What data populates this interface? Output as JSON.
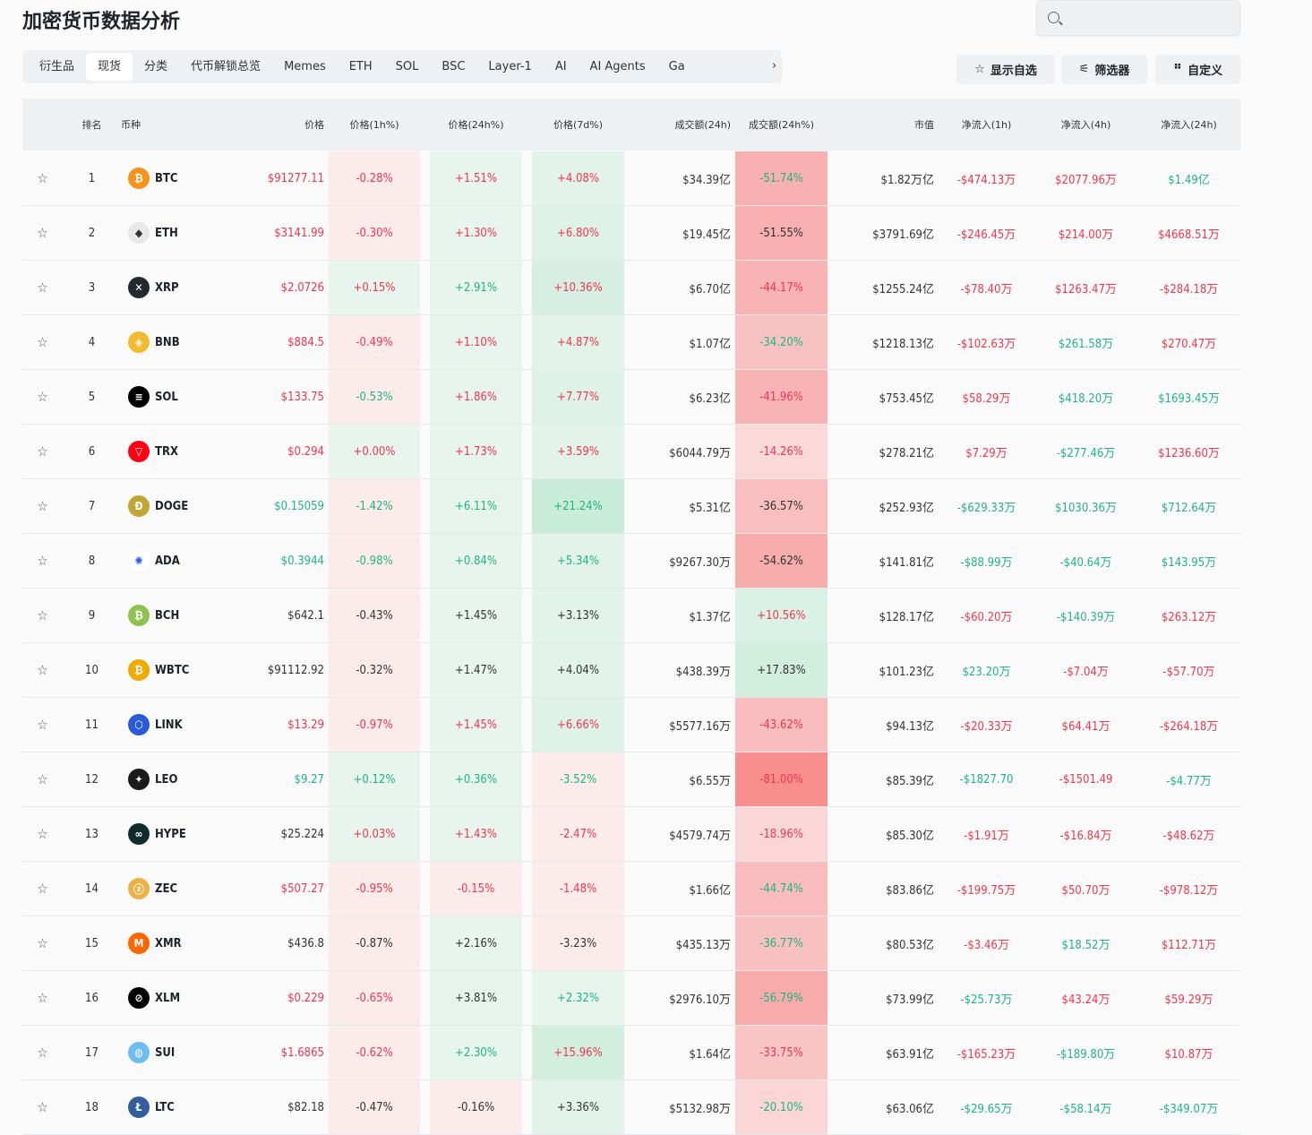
{
  "title": "加密货币数据分析",
  "search": {
    "placeholder": ""
  },
  "tabs": [
    "衍生品",
    "现货",
    "分类",
    "代币解锁总览",
    "Memes",
    "ETH",
    "SOL",
    "BSC",
    "Layer-1",
    "AI",
    "AI Agents",
    "Ga"
  ],
  "active_tab": 1,
  "buttons": {
    "watchlist": "显示自选",
    "filter": "筛选器",
    "customize": "自定义"
  },
  "columns": [
    "排名",
    "币种",
    "价格",
    "价格(1h%)",
    "价格(24h%)",
    "价格(7d%)",
    "成交额(24h)",
    "成交额(24h%)",
    "市值",
    "净流入(1h)",
    "净流入(4h)",
    "净流入(24h)"
  ],
  "colors": {
    "r": "#f0364f",
    "g": "#20b482",
    "k": "#333333"
  },
  "rows": [
    {
      "rank": "1",
      "sym": "BTC",
      "icon": "#f7931a",
      "glyph": "₿",
      "price": [
        "$91277.11",
        "r"
      ],
      "h1": [
        "-0.28%",
        "r",
        "#fcebeb"
      ],
      "h24": [
        "+1.51%",
        "r",
        "#e8f5ee"
      ],
      "d7": [
        "+4.08%",
        "r",
        "#e2f3ea"
      ],
      "vol": "$34.39亿",
      "volp": [
        "-51.74%",
        "g",
        "#f8b0b0"
      ],
      "mcap": "$1.82万亿",
      "f1": [
        "-$474.13万",
        "r"
      ],
      "f4": [
        "$2077.96万",
        "r"
      ],
      "f24": [
        "$1.49亿",
        "g"
      ]
    },
    {
      "rank": "2",
      "sym": "ETH",
      "icon": "#e8e8e8",
      "glyph": "◆",
      "price": [
        "$3141.99",
        "r"
      ],
      "h1": [
        "-0.30%",
        "r",
        "#fcebeb"
      ],
      "h24": [
        "+1.30%",
        "r",
        "#e8f5ee"
      ],
      "d7": [
        "+6.80%",
        "r",
        "#def2e7"
      ],
      "vol": "$19.45亿",
      "volp": [
        "-51.55%",
        "k",
        "#f8b0b0"
      ],
      "mcap": "$3791.69亿",
      "f1": [
        "-$246.45万",
        "r"
      ],
      "f4": [
        "$214.00万",
        "r"
      ],
      "f24": [
        "$4668.51万",
        "r"
      ]
    },
    {
      "rank": "3",
      "sym": "XRP",
      "icon": "#23292f",
      "glyph": "✕",
      "price": [
        "$2.0726",
        "r"
      ],
      "h1": [
        "+0.15%",
        "r",
        "#e8f5ee"
      ],
      "h24": [
        "+2.91%",
        "g",
        "#e8f5ee"
      ],
      "d7": [
        "+10.36%",
        "r",
        "#d6efe2"
      ],
      "vol": "$6.70亿",
      "volp": [
        "-44.17%",
        "r",
        "#f8b4b4"
      ],
      "mcap": "$1255.24亿",
      "f1": [
        "-$78.40万",
        "r"
      ],
      "f4": [
        "$1263.47万",
        "r"
      ],
      "f24": [
        "-$284.18万",
        "r"
      ]
    },
    {
      "rank": "4",
      "sym": "BNB",
      "icon": "#f3ba2f",
      "glyph": "◈",
      "price": [
        "$884.5",
        "r"
      ],
      "h1": [
        "-0.49%",
        "r",
        "#fcebeb"
      ],
      "h24": [
        "+1.10%",
        "r",
        "#e8f5ee"
      ],
      "d7": [
        "+4.87%",
        "r",
        "#e2f3ea"
      ],
      "vol": "$1.07亿",
      "volp": [
        "-34.20%",
        "g",
        "#f9c2c2"
      ],
      "mcap": "$1218.13亿",
      "f1": [
        "-$102.63万",
        "r"
      ],
      "f4": [
        "$261.58万",
        "g"
      ],
      "f24": [
        "$270.47万",
        "r"
      ]
    },
    {
      "rank": "5",
      "sym": "SOL",
      "icon": "#000000",
      "glyph": "≡",
      "price": [
        "$133.75",
        "r"
      ],
      "h1": [
        "-0.53%",
        "g",
        "#fcebeb"
      ],
      "h24": [
        "+1.86%",
        "r",
        "#e8f5ee"
      ],
      "d7": [
        "+7.77%",
        "r",
        "#def2e7"
      ],
      "vol": "$6.23亿",
      "volp": [
        "-41.96%",
        "r",
        "#f8b4b4"
      ],
      "mcap": "$753.45亿",
      "f1": [
        "$58.29万",
        "r"
      ],
      "f4": [
        "$418.20万",
        "g"
      ],
      "f24": [
        "$1693.45万",
        "g"
      ]
    },
    {
      "rank": "6",
      "sym": "TRX",
      "icon": "#ff0013",
      "glyph": "▽",
      "price": [
        "$0.294",
        "r"
      ],
      "h1": [
        "+0.00%",
        "r",
        "#e8f5ee"
      ],
      "h24": [
        "+1.73%",
        "r",
        "#e8f5ee"
      ],
      "d7": [
        "+3.59%",
        "r",
        "#e2f3ea"
      ],
      "vol": "$6044.79万",
      "volp": [
        "-14.26%",
        "r",
        "#fbd9d9"
      ],
      "mcap": "$278.21亿",
      "f1": [
        "$7.29万",
        "r"
      ],
      "f4": [
        "-$277.46万",
        "g"
      ],
      "f24": [
        "$1236.60万",
        "r"
      ]
    },
    {
      "rank": "7",
      "sym": "DOGE",
      "icon": "#c2a633",
      "glyph": "Ð",
      "price": [
        "$0.15059",
        "g"
      ],
      "h1": [
        "-1.42%",
        "g",
        "#fcebeb"
      ],
      "h24": [
        "+6.11%",
        "g",
        "#e6f4ec"
      ],
      "d7": [
        "+21.24%",
        "g",
        "#c8ebda"
      ],
      "vol": "$5.31亿",
      "volp": [
        "-36.57%",
        "k",
        "#f9bfbf"
      ],
      "mcap": "$252.93亿",
      "f1": [
        "-$629.33万",
        "g"
      ],
      "f4": [
        "$1030.36万",
        "g"
      ],
      "f24": [
        "$712.64万",
        "g"
      ]
    },
    {
      "rank": "8",
      "sym": "ADA",
      "icon": "#ffffff",
      "glyph": "✺",
      "price": [
        "$0.3944",
        "g"
      ],
      "h1": [
        "-0.98%",
        "g",
        "#fcebeb"
      ],
      "h24": [
        "+0.84%",
        "g",
        "#e8f5ee"
      ],
      "d7": [
        "+5.34%",
        "g",
        "#e2f3ea"
      ],
      "vol": "$9267.30万",
      "volp": [
        "-54.62%",
        "k",
        "#f8adad"
      ],
      "mcap": "$141.81亿",
      "f1": [
        "-$88.99万",
        "g"
      ],
      "f4": [
        "-$40.64万",
        "g"
      ],
      "f24": [
        "$143.95万",
        "g"
      ]
    },
    {
      "rank": "9",
      "sym": "BCH",
      "icon": "#8dc351",
      "glyph": "₿",
      "price": [
        "$642.1",
        "k"
      ],
      "h1": [
        "-0.43%",
        "k",
        "#fcebeb"
      ],
      "h24": [
        "+1.45%",
        "k",
        "#e8f5ee"
      ],
      "d7": [
        "+3.13%",
        "k",
        "#e2f3ea"
      ],
      "vol": "$1.37亿",
      "volp": [
        "+10.56%",
        "r",
        "#daf1e5"
      ],
      "mcap": "$128.17亿",
      "f1": [
        "-$60.20万",
        "r"
      ],
      "f4": [
        "-$140.39万",
        "g"
      ],
      "f24": [
        "$263.12万",
        "r"
      ]
    },
    {
      "rank": "10",
      "sym": "WBTC",
      "icon": "#f2a900",
      "glyph": "₿",
      "price": [
        "$91112.92",
        "k"
      ],
      "h1": [
        "-0.32%",
        "k",
        "#fcebeb"
      ],
      "h24": [
        "+1.47%",
        "k",
        "#e8f5ee"
      ],
      "d7": [
        "+4.04%",
        "k",
        "#e2f3ea"
      ],
      "vol": "$438.39万",
      "volp": [
        "+17.83%",
        "k",
        "#d2eedf"
      ],
      "mcap": "$101.23亿",
      "f1": [
        "$23.20万",
        "g"
      ],
      "f4": [
        "-$7.04万",
        "r"
      ],
      "f24": [
        "-$57.70万",
        "r"
      ]
    },
    {
      "rank": "11",
      "sym": "LINK",
      "icon": "#2a5ada",
      "glyph": "⬡",
      "price": [
        "$13.29",
        "r"
      ],
      "h1": [
        "-0.97%",
        "r",
        "#fcebeb"
      ],
      "h24": [
        "+1.45%",
        "r",
        "#e8f5ee"
      ],
      "d7": [
        "+6.66%",
        "r",
        "#def2e7"
      ],
      "vol": "$5577.16万",
      "volp": [
        "-43.62%",
        "r",
        "#f9bdbd"
      ],
      "mcap": "$94.13亿",
      "f1": [
        "-$20.33万",
        "r"
      ],
      "f4": [
        "$64.41万",
        "r"
      ],
      "f24": [
        "-$264.18万",
        "r"
      ]
    },
    {
      "rank": "12",
      "sym": "LEO",
      "icon": "#1b1b1b",
      "glyph": "✦",
      "price": [
        "$9.27",
        "g"
      ],
      "h1": [
        "+0.12%",
        "g",
        "#e8f5ee"
      ],
      "h24": [
        "+0.36%",
        "g",
        "#e8f5ee"
      ],
      "d7": [
        "-3.52%",
        "g",
        "#fcebeb"
      ],
      "vol": "$6.55万",
      "volp": [
        "-81.00%",
        "r",
        "#f78f8f"
      ],
      "mcap": "$85.39亿",
      "f1": [
        "-$1827.70",
        "g"
      ],
      "f4": [
        "-$1501.49",
        "r"
      ],
      "f24": [
        "-$4.77万",
        "g"
      ]
    },
    {
      "rank": "13",
      "sym": "HYPE",
      "icon": "#0f2b2b",
      "glyph": "∞",
      "price": [
        "$25.224",
        "k"
      ],
      "h1": [
        "+0.03%",
        "r",
        "#e8f5ee"
      ],
      "h24": [
        "+1.43%",
        "r",
        "#e8f5ee"
      ],
      "d7": [
        "-2.47%",
        "r",
        "#fcebeb"
      ],
      "vol": "$4579.74万",
      "volp": [
        "-18.96%",
        "r",
        "#fad6d6"
      ],
      "mcap": "$85.30亿",
      "f1": [
        "-$1.91万",
        "r"
      ],
      "f4": [
        "-$16.84万",
        "r"
      ],
      "f24": [
        "-$48.62万",
        "r"
      ]
    },
    {
      "rank": "14",
      "sym": "ZEC",
      "icon": "#ecb244",
      "glyph": "ⓩ",
      "price": [
        "$507.27",
        "r"
      ],
      "h1": [
        "-0.95%",
        "r",
        "#fcebeb"
      ],
      "h24": [
        "-0.15%",
        "r",
        "#fcebeb"
      ],
      "d7": [
        "-1.48%",
        "r",
        "#fcebeb"
      ],
      "vol": "$1.66亿",
      "volp": [
        "-44.74%",
        "g",
        "#f9bdbd"
      ],
      "mcap": "$83.86亿",
      "f1": [
        "-$199.75万",
        "r"
      ],
      "f4": [
        "$50.70万",
        "r"
      ],
      "f24": [
        "-$978.12万",
        "r"
      ]
    },
    {
      "rank": "15",
      "sym": "XMR",
      "icon": "#ff6600",
      "glyph": "M",
      "price": [
        "$436.8",
        "k"
      ],
      "h1": [
        "-0.87%",
        "k",
        "#fcebeb"
      ],
      "h24": [
        "+2.16%",
        "k",
        "#e8f5ee"
      ],
      "d7": [
        "-3.23%",
        "k",
        "#fcebeb"
      ],
      "vol": "$435.13万",
      "volp": [
        "-36.77%",
        "g",
        "#f9c0c0"
      ],
      "mcap": "$80.53亿",
      "f1": [
        "-$3.46万",
        "r"
      ],
      "f4": [
        "$18.52万",
        "g"
      ],
      "f24": [
        "$112.71万",
        "r"
      ]
    },
    {
      "rank": "16",
      "sym": "XLM",
      "icon": "#000000",
      "glyph": "⊘",
      "price": [
        "$0.229",
        "r"
      ],
      "h1": [
        "-0.65%",
        "r",
        "#fcebeb"
      ],
      "h24": [
        "+3.81%",
        "k",
        "#e6f4ec"
      ],
      "d7": [
        "+2.32%",
        "g",
        "#e8f5ee"
      ],
      "vol": "$2976.10万",
      "volp": [
        "-56.79%",
        "g",
        "#f8abab"
      ],
      "mcap": "$73.99亿",
      "f1": [
        "-$25.73万",
        "g"
      ],
      "f4": [
        "$43.24万",
        "r"
      ],
      "f24": [
        "$59.29万",
        "r"
      ]
    },
    {
      "rank": "17",
      "sym": "SUI",
      "icon": "#6fbcf0",
      "glyph": "◍",
      "price": [
        "$1.6865",
        "r"
      ],
      "h1": [
        "-0.62%",
        "r",
        "#fcebeb"
      ],
      "h24": [
        "+2.30%",
        "g",
        "#e8f5ee"
      ],
      "d7": [
        "+15.96%",
        "r",
        "#d2eedf"
      ],
      "vol": "$1.64亿",
      "volp": [
        "-33.75%",
        "r",
        "#f9c4c4"
      ],
      "mcap": "$63.91亿",
      "f1": [
        "-$165.23万",
        "r"
      ],
      "f4": [
        "-$189.80万",
        "g"
      ],
      "f24": [
        "$10.87万",
        "r"
      ]
    },
    {
      "rank": "18",
      "sym": "LTC",
      "icon": "#345d9d",
      "glyph": "Ł",
      "price": [
        "$82.18",
        "k"
      ],
      "h1": [
        "-0.47%",
        "k",
        "#fcebeb"
      ],
      "h24": [
        "-0.16%",
        "k",
        "#fcebeb"
      ],
      "d7": [
        "+3.36%",
        "k",
        "#e2f3ea"
      ],
      "vol": "$5132.98万",
      "volp": [
        "-20.10%",
        "g",
        "#fad6d6"
      ],
      "mcap": "$63.06亿",
      "f1": [
        "-$29.65万",
        "g"
      ],
      "f4": [
        "-$58.14万",
        "g"
      ],
      "f24": [
        "-$349.07万",
        "g"
      ]
    }
  ]
}
